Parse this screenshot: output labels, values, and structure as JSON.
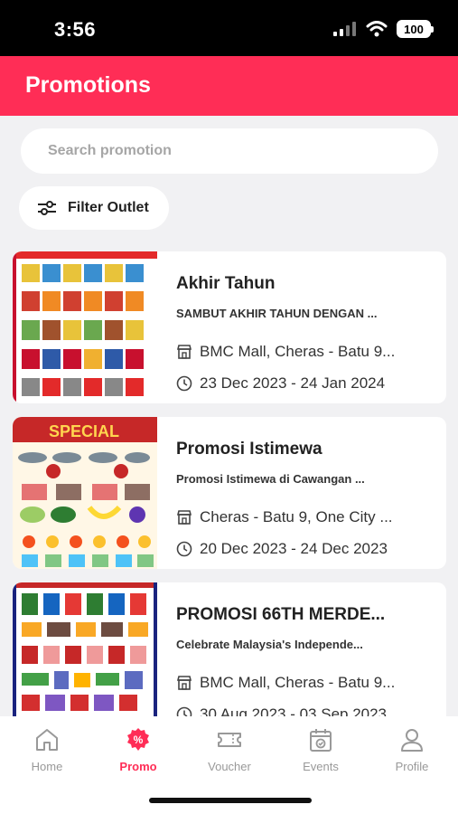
{
  "status_bar": {
    "time": "3:56",
    "battery": "100"
  },
  "header": {
    "title": "Promotions"
  },
  "search": {
    "placeholder": "Search promotion"
  },
  "filter": {
    "label": "Filter Outlet"
  },
  "promotions": [
    {
      "title": "Akhir Tahun",
      "subtitle": "SAMBUT AKHIR TAHUN DENGAN ...",
      "outlet": "BMC Mall, Cheras - Batu 9...",
      "dates": "23 Dec 2023 - 24 Jan 2024",
      "flyer_theme": "red"
    },
    {
      "title": "Promosi Istimewa",
      "subtitle": "Promosi Istimewa di Cawangan ...",
      "outlet": "Cheras - Batu 9, One City ...",
      "dates": "20 Dec 2023 - 24 Dec 2023",
      "flyer_theme": "gold",
      "flyer_banner": "SPECIAL"
    },
    {
      "title": "PROMOSI 66TH MERDE...",
      "subtitle": "Celebrate Malaysia's Independe...",
      "outlet": "BMC Mall, Cheras - Batu 9...",
      "dates": "30 Aug 2023 - 03 Sep 2023",
      "flyer_theme": "blue"
    }
  ],
  "tabs": [
    {
      "label": "Home",
      "icon": "home-icon",
      "active": false
    },
    {
      "label": "Promo",
      "icon": "promo-icon",
      "active": true
    },
    {
      "label": "Voucher",
      "icon": "voucher-icon",
      "active": false
    },
    {
      "label": "Events",
      "icon": "events-icon",
      "active": false
    },
    {
      "label": "Profile",
      "icon": "profile-icon",
      "active": false
    }
  ],
  "colors": {
    "accent": "#ff2d56",
    "background": "#f1f1f3",
    "inactive": "#999999"
  }
}
